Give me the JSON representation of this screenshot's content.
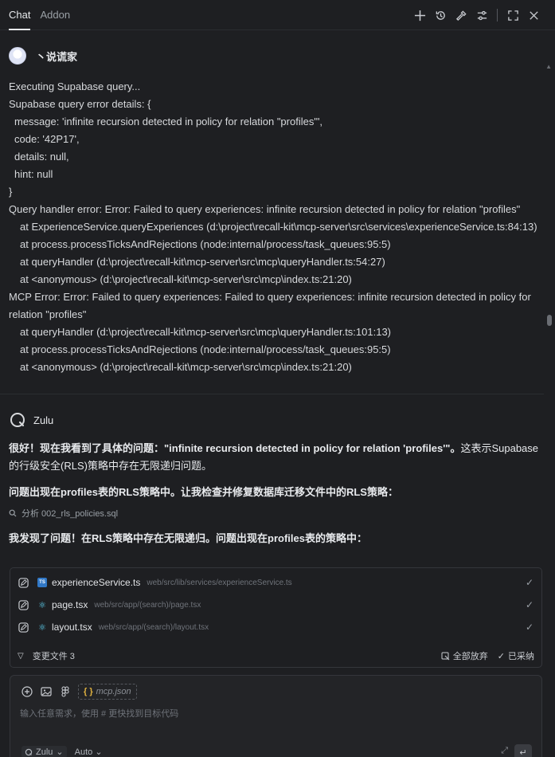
{
  "tabs": [
    {
      "label": "Chat",
      "active": true
    },
    {
      "label": "Addon",
      "active": false
    }
  ],
  "toolbar": {
    "icons": [
      "plus-icon",
      "history-icon",
      "tool-icon",
      "settings-sliders-icon",
      "maximize-icon",
      "close-icon"
    ]
  },
  "user": {
    "name": "丶说谎家"
  },
  "log_lines": [
    {
      "text": "Executing Supabase query...",
      "indent": 0
    },
    {
      "text": "Supabase query error details: {",
      "indent": 0
    },
    {
      "text": "message: 'infinite recursion detected in policy for relation \"profiles\"',",
      "indent": 1
    },
    {
      "text": "code: '42P17',",
      "indent": 1
    },
    {
      "text": "details: null,",
      "indent": 1
    },
    {
      "text": "hint: null",
      "indent": 1
    },
    {
      "text": "}",
      "indent": 0
    },
    {
      "text": "Query handler error: Error: Failed to query experiences: infinite recursion detected in policy for relation \"profiles\"",
      "indent": 0
    },
    {
      "text": "at ExperienceService.queryExperiences (d:\\project\\recall-kit\\mcp-server\\src\\services\\experienceService.ts:84:13)",
      "indent": 2
    },
    {
      "text": "at process.processTicksAndRejections (node:internal/process/task_queues:95:5)",
      "indent": 2
    },
    {
      "text": "at queryHandler (d:\\project\\recall-kit\\mcp-server\\src\\mcp\\queryHandler.ts:54:27)",
      "indent": 2
    },
    {
      "text": "at <anonymous> (d:\\project\\recall-kit\\mcp-server\\src\\mcp\\index.ts:21:20)",
      "indent": 2
    },
    {
      "text": "MCP Error: Error: Failed to query experiences: Failed to query experiences: infinite recursion detected in policy for relation \"profiles\"",
      "indent": 0
    },
    {
      "text": "at queryHandler (d:\\project\\recall-kit\\mcp-server\\src\\mcp\\queryHandler.ts:101:13)",
      "indent": 2
    },
    {
      "text": "at process.processTicksAndRejections (node:internal/process/task_queues:95:5)",
      "indent": 2
    },
    {
      "text": "at <anonymous> (d:\\project\\recall-kit\\mcp-server\\src\\mcp\\index.ts:21:20)",
      "indent": 2
    }
  ],
  "bot": {
    "name": "Zulu",
    "reply_part1": "很好！现在我看到了具体的问题：\"infinite recursion detected in policy for relation 'profiles'\"。",
    "reply_part2": "这表示Supabase的行级安全(RLS)策略中存在无限递归问题。",
    "reply_line2": "问题出现在profiles表的RLS策略中。让我检查并修复数据库迁移文件中的RLS策略：",
    "tool_action": "分析 002_rls_policies.sql",
    "reply_line3": "我发现了问题！在RLS策略中存在无限递归。问题出现在profiles表的策略中："
  },
  "files": {
    "items": [
      {
        "name": "experienceService.ts",
        "path": "web/src/lib/services/experienceService.ts",
        "type": "ts"
      },
      {
        "name": "page.tsx",
        "path": "web/src/app/(search)/page.tsx",
        "type": "react"
      },
      {
        "name": "layout.tsx",
        "path": "web/src/app/(search)/layout.tsx",
        "type": "react"
      }
    ],
    "summary": "变更文件 3",
    "discard_all": "全部放弃",
    "accepted": "已采纳"
  },
  "input": {
    "context_chip": "mcp.json",
    "context_brace": "{ }",
    "placeholder": "输入任意需求，使用 # 更快找到目标代码",
    "model": "Zulu",
    "mode": "Auto"
  }
}
